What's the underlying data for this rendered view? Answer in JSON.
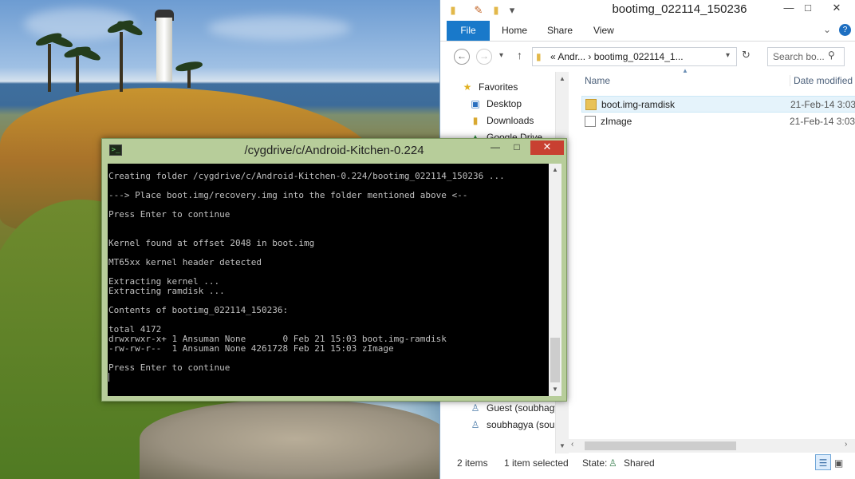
{
  "explorer": {
    "title": "bootimg_022114_150236",
    "window_controls": {
      "minimize": "—",
      "maximize": "□",
      "close": "✕"
    },
    "ribbon_tabs": [
      "File",
      "Home",
      "Share",
      "View"
    ],
    "address_segments": "«  Andr...  ›  bootimg_022114_1...",
    "search_placeholder": "Search bo...",
    "nav_items": [
      {
        "label": "Favorites",
        "icon": "star-icon"
      },
      {
        "label": "Desktop",
        "icon": "desktop-icon"
      },
      {
        "label": "Downloads",
        "icon": "downloads-icon"
      },
      {
        "label": "Google Drive",
        "icon": "google-drive-icon"
      },
      {
        "label": "Guest (soubhagy",
        "icon": "user-icon"
      },
      {
        "label": "soubhagya (soul",
        "icon": "user-icon"
      }
    ],
    "columns": {
      "name": "Name",
      "date": "Date modified"
    },
    "files": [
      {
        "name": "boot.img-ramdisk",
        "date": "21-Feb-14 3:03",
        "type": "folder"
      },
      {
        "name": "zImage",
        "date": "21-Feb-14 3:03",
        "type": "file"
      }
    ],
    "status": {
      "count": "2 items",
      "selection": "1 item selected",
      "state_label": "State:",
      "state_value": "Shared"
    }
  },
  "terminal": {
    "title": "/cygdrive/c/Android-Kitchen-0.224",
    "controls": {
      "minimize": "—",
      "maximize": "□",
      "close": "✕"
    },
    "text": "Creating folder /cygdrive/c/Android-Kitchen-0.224/bootimg_022114_150236 ...\n\n---> Place boot.img/recovery.img into the folder mentioned above <--\n\nPress Enter to continue\n\n\nKernel found at offset 2048 in boot.img\n\nMT65xx kernel header detected\n\nExtracting kernel ...\nExtracting ramdisk ...\n\nContents of bootimg_022114_150236:\n\ntotal 4172\ndrwxrwxr-x+ 1 Ansuman None       0 Feb 21 15:03 boot.img-ramdisk\n-rw-rw-r--  1 Ansuman None 4261728 Feb 21 15:03 zImage\n\nPress Enter to continue\n"
  },
  "colors": {
    "file_tab": "#1979ca",
    "terminal_frame": "#b7cd9a",
    "close_red": "#c84031"
  }
}
